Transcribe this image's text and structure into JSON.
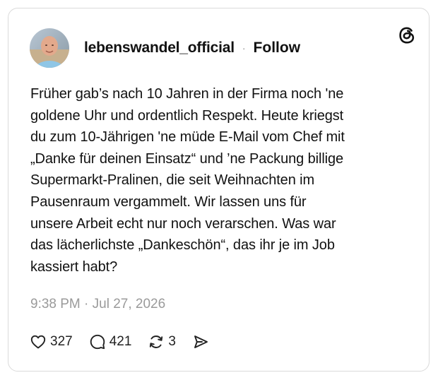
{
  "post": {
    "username": "lebenswandel_official",
    "separator": "·",
    "follow_label": "Follow",
    "text": "Früher gab’s nach 10 Jahren in der Firma noch 'ne\ngoldene Uhr und ordentlich Respekt. Heute kriegst\ndu zum 10-Jährigen 'ne müde E-Mail vom Chef mit\n„Danke für deinen Einsatz“ und ’ne Packung billige\nSupermarkt-Pralinen, die seit Weihnachten im\nPausenraum vergammelt. Wir lassen uns für\nunsere Arbeit echt nur noch verarschen. Was war\ndas lächerlichste „Dankeschön“, das ihr je im Job\nkassiert habt?",
    "timestamp": "9:38 PM · Jul 27, 2026"
  },
  "actions": {
    "likes": "327",
    "replies": "421",
    "reposts": "3"
  },
  "icons": {
    "logo": "threads-logo-icon",
    "like": "heart-icon",
    "reply": "comment-bubble-icon",
    "repost": "repost-icon",
    "share": "send-icon"
  },
  "colors": {
    "text": "#111111",
    "muted": "#9a9a9a",
    "border": "#dadada",
    "background": "#ffffff"
  }
}
